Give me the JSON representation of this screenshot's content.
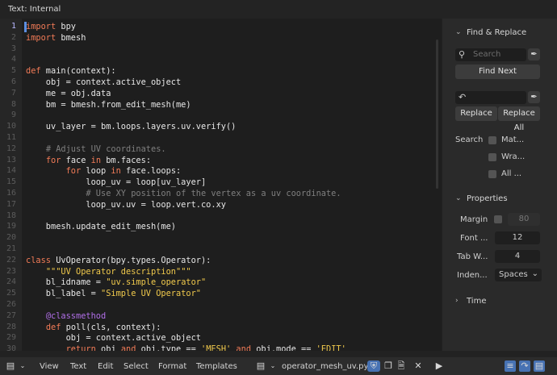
{
  "header": {
    "title": "Text: Internal"
  },
  "code_lines": [
    {
      "n": "1",
      "html": "<span class=\"kw\">import</span> bpy"
    },
    {
      "n": "2",
      "html": "<span class=\"kw\">import</span> bmesh"
    },
    {
      "n": "3",
      "html": ""
    },
    {
      "n": "4",
      "html": ""
    },
    {
      "n": "5",
      "html": "<span class=\"kw\">def</span> main(context):"
    },
    {
      "n": "6",
      "html": "    obj = context.active_object"
    },
    {
      "n": "7",
      "html": "    me = obj.data"
    },
    {
      "n": "8",
      "html": "    bm = bmesh.from_edit_mesh(me)"
    },
    {
      "n": "9",
      "html": ""
    },
    {
      "n": "10",
      "html": "    uv_layer = bm.loops.layers.uv.verify()"
    },
    {
      "n": "11",
      "html": ""
    },
    {
      "n": "12",
      "html": "    <span class=\"cm\"># Adjust UV coordinates.</span>"
    },
    {
      "n": "13",
      "html": "    <span class=\"kw\">for</span> face <span class=\"kw\">in</span> bm.faces:"
    },
    {
      "n": "14",
      "html": "        <span class=\"kw\">for</span> loop <span class=\"kw\">in</span> face.loops:"
    },
    {
      "n": "15",
      "html": "            loop_uv = loop[uv_layer]"
    },
    {
      "n": "16",
      "html": "            <span class=\"cm\"># Use XY position of the vertex as a uv coordinate.</span>"
    },
    {
      "n": "17",
      "html": "            loop_uv.uv = loop.vert.co.xy"
    },
    {
      "n": "18",
      "html": ""
    },
    {
      "n": "19",
      "html": "    bmesh.update_edit_mesh(me)"
    },
    {
      "n": "20",
      "html": ""
    },
    {
      "n": "21",
      "html": ""
    },
    {
      "n": "22",
      "html": "<span class=\"kw\">class</span> UvOperator(bpy.types.Operator):"
    },
    {
      "n": "23",
      "html": "    <span class=\"st\">\"\"\"UV Operator description\"\"\"</span>"
    },
    {
      "n": "24",
      "html": "    bl_idname = <span class=\"st\">\"uv.simple_operator\"</span>"
    },
    {
      "n": "25",
      "html": "    bl_label = <span class=\"st\">\"Simple UV Operator\"</span>"
    },
    {
      "n": "26",
      "html": ""
    },
    {
      "n": "27",
      "html": "    <span class=\"dc\">@classmethod</span>"
    },
    {
      "n": "28",
      "html": "    <span class=\"kw\">def</span> poll(cls, context):"
    },
    {
      "n": "29",
      "html": "        obj = context.active_object"
    },
    {
      "n": "30",
      "html": "        <span class=\"kw\">return</span> obj <span class=\"kw\">and</span> obj.type == <span class=\"st\">'MESH'</span> <span class=\"kw\">and</span> obj.mode == <span class=\"st\">'EDIT'</span>"
    }
  ],
  "sidebar": {
    "find_replace": {
      "title": "Find & Replace",
      "search_placeholder": "Search",
      "find_next": "Find Next",
      "replace": "Replace",
      "replace_all": "Replace All",
      "search_label": "Search",
      "options": [
        "Mat...",
        "Wra...",
        "All ..."
      ]
    },
    "properties": {
      "title": "Properties",
      "margin_label": "Margin",
      "margin_value": "80",
      "font_label": "Font ...",
      "font_value": "12",
      "tab_label": "Tab W...",
      "tab_value": "4",
      "indent_label": "Inden...",
      "indent_value": "Spaces"
    },
    "time": {
      "title": "Time"
    }
  },
  "footer": {
    "menus": [
      "View",
      "Text",
      "Edit",
      "Select",
      "Format",
      "Templates"
    ],
    "filename": "operator_mesh_uv.py"
  }
}
